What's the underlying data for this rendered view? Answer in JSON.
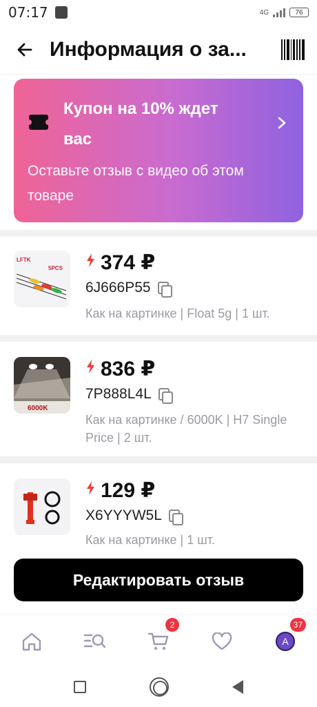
{
  "status_bar": {
    "time": "07:17",
    "network": "4G",
    "battery": "76"
  },
  "header": {
    "title": "Информация о за..."
  },
  "coupon": {
    "headline": "Купон на 10% ждет вас",
    "subtitle": "Оставьте отзыв с видео об этом товаре"
  },
  "items": [
    {
      "thumb_label": "5PCS",
      "thumb_brand": "LFTK",
      "price": "374 ₽",
      "code": "6J666P55",
      "variant": "Как на картинке | Float 5g | 1 шт."
    },
    {
      "thumb_label": "6000K",
      "price": "836 ₽",
      "code": "7P888L4L",
      "variant": "Как на картинке / 6000K | H7 Single Price | 2 шт."
    },
    {
      "price": "129 ₽",
      "code": "X6YYYW5L",
      "variant": "Как на картинке | 1 шт."
    }
  ],
  "edit_button": {
    "label": "Редактировать отзыв"
  },
  "bottom_nav": {
    "cart_badge": "2",
    "profile_badge": "37",
    "avatar_letter": "A"
  },
  "colors": {
    "coupon_gradient_start": "#ef6496",
    "coupon_gradient_end": "#8f62e0",
    "bolt": "#f23b3b",
    "badge": "#ef3340"
  }
}
